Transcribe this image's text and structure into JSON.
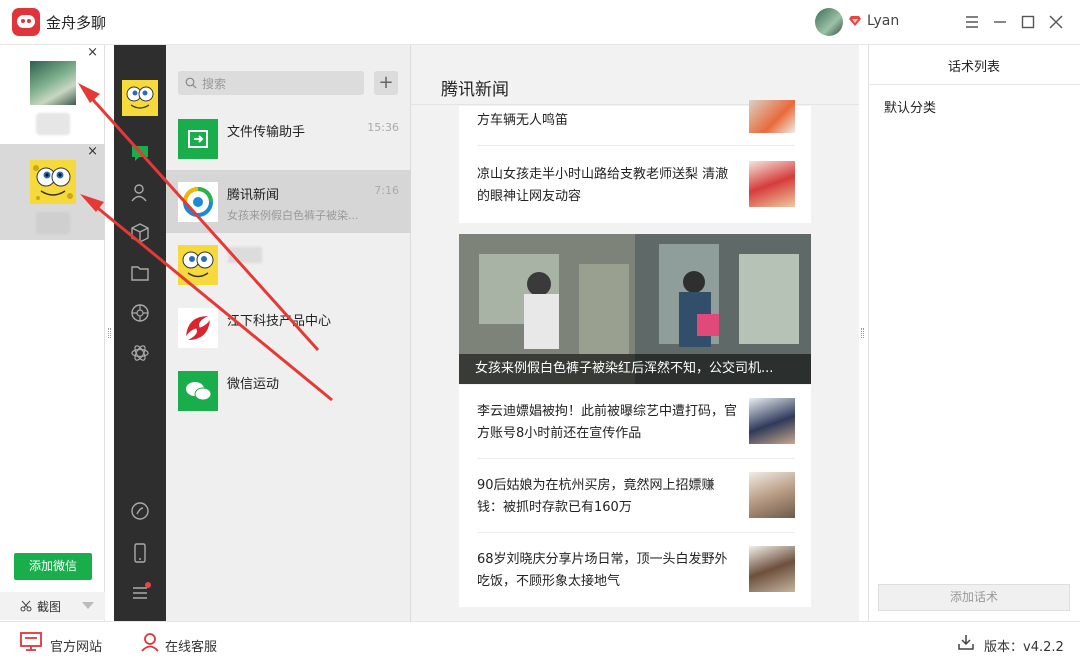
{
  "app": {
    "title": "金舟多聊",
    "user_name": "Lyan"
  },
  "accounts": {
    "close_glyph": "×"
  },
  "sidebar_bottom": {
    "add_wechat": "添加微信",
    "screenshot": "截图"
  },
  "search": {
    "placeholder": "搜索",
    "plus": "+"
  },
  "chats": [
    {
      "name": "文件传输助手",
      "time": "15:36",
      "preview": ""
    },
    {
      "name": "腾讯新闻",
      "time": "7:16",
      "preview": "女孩来例假白色裤子被染..."
    },
    {
      "name": "",
      "time": "",
      "preview": ""
    },
    {
      "name": "江下科技产品中心",
      "time": "",
      "preview": ""
    },
    {
      "name": "微信运动",
      "time": "",
      "preview": ""
    }
  ],
  "main": {
    "title": "腾讯新闻",
    "news_top": [
      {
        "title": "方车辆无人鸣笛"
      },
      {
        "title": "凉山女孩走半小时山路给支教老师送梨 清澈的眼神让网友动容"
      }
    ],
    "hero_caption": "女孩来例假白色裤子被染红后浑然不知，公交司机...",
    "news_bottom": [
      {
        "title": "李云迪嫖娼被拘！此前被曝综艺中遭打码，官方账号8小时前还在宣传作品"
      },
      {
        "title": "90后姑娘为在杭州买房，竟然网上招嫖赚钱：被抓时存款已有160万"
      },
      {
        "title": "68岁刘晓庆分享片场日常，顶一头白发野外吃饭，不顾形象太接地气"
      }
    ]
  },
  "scripts_panel": {
    "title": "话术列表",
    "default_category": "默认分类",
    "add_button": "添加话术"
  },
  "footer": {
    "official_site": "官方网站",
    "online_service": "在线客服",
    "version": "版本：v4.2.2"
  },
  "colors": {
    "brand_red": "#e0343a",
    "wechat_green": "#1aad4b",
    "rail_dark": "#2e2e2e"
  }
}
